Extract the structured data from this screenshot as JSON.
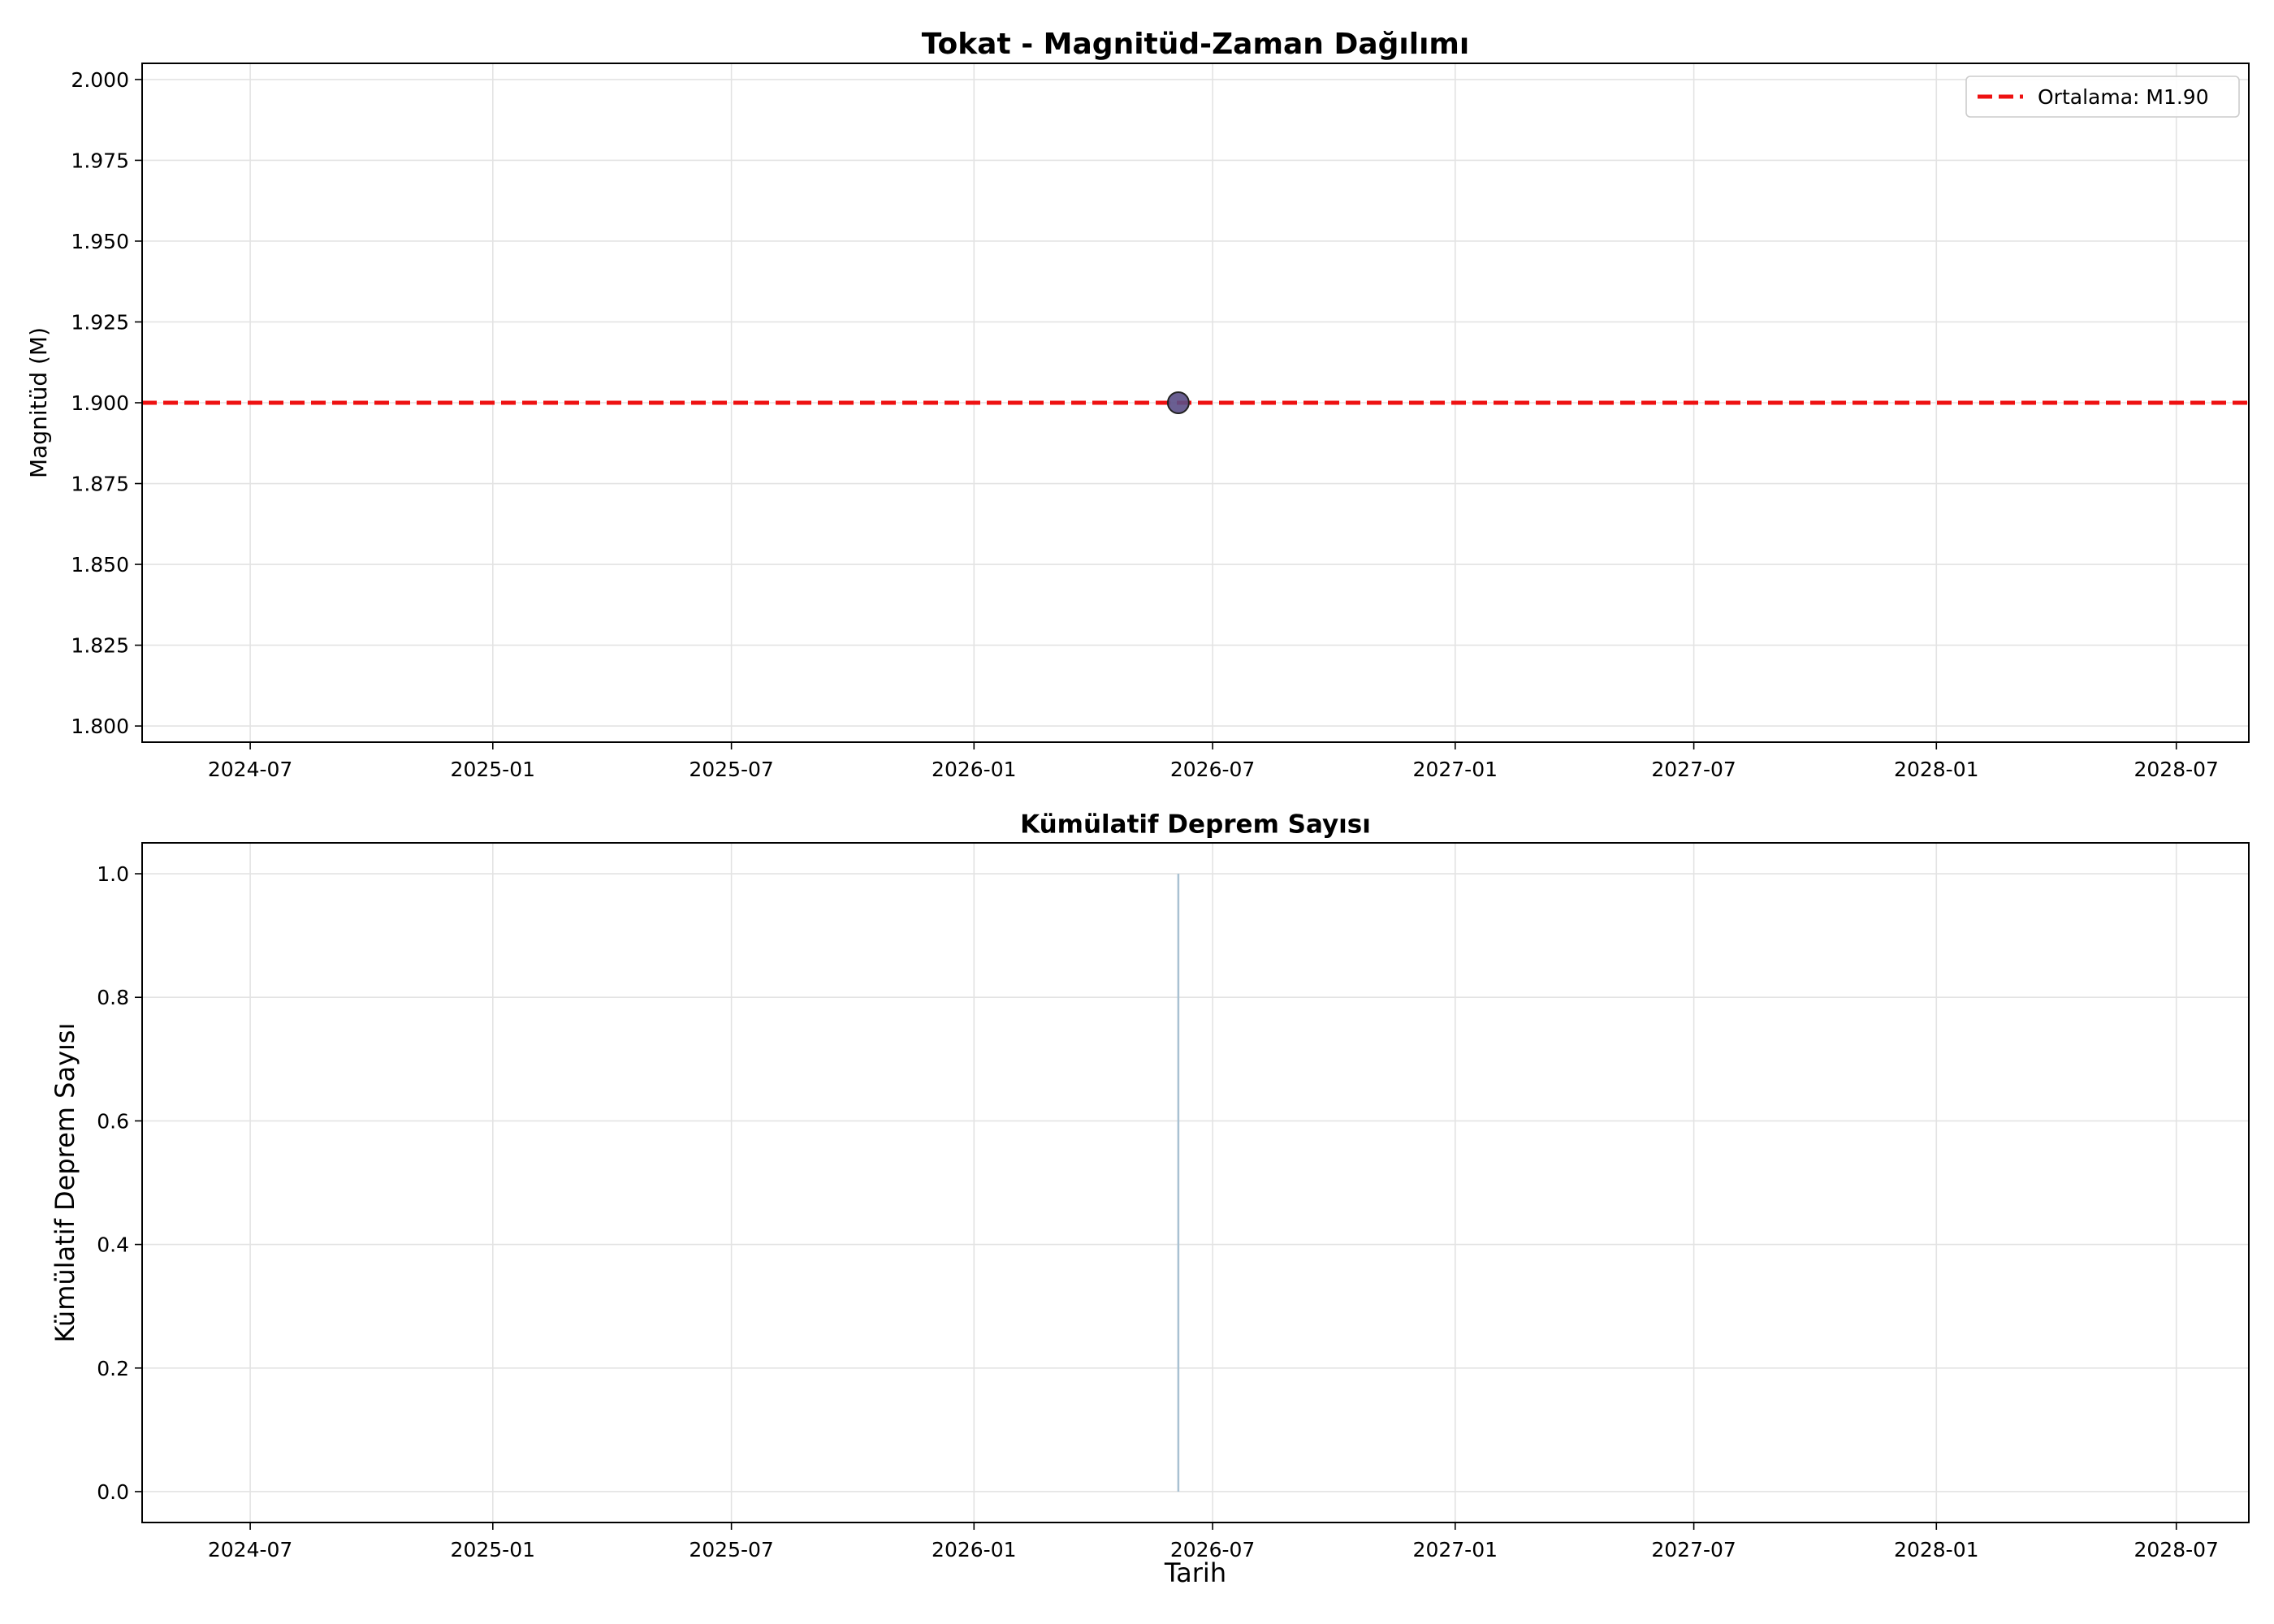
{
  "chart_data": [
    {
      "type": "scatter",
      "title": "Tokat - Magnitüd-Zaman Dağılımı",
      "xlabel": "",
      "ylabel": "Magnitüd (M)",
      "x_ticks": [
        "2024-07",
        "2025-01",
        "2025-07",
        "2026-01",
        "2026-07",
        "2027-01",
        "2027-07",
        "2028-01",
        "2028-07"
      ],
      "y_ticks": [
        "1.800",
        "1.825",
        "1.850",
        "1.875",
        "1.900",
        "1.925",
        "1.950",
        "1.975",
        "2.000"
      ],
      "xlim": [
        "2024-04-10",
        "2028-08-25"
      ],
      "ylim": [
        1.795,
        2.005
      ],
      "grid": true,
      "legend_position": "top-right",
      "points": [
        {
          "x": "2026-06-05",
          "y": 1.9
        }
      ],
      "reference_line": {
        "y": 1.9,
        "label": "Ortalama: M1.90",
        "style": "dashed",
        "color": "#ee1111"
      },
      "marker_color": "#5a4e86"
    },
    {
      "type": "line",
      "title": "Kümülatif Deprem Sayısı",
      "xlabel": "Tarih",
      "ylabel": "Kümülatif Deprem Sayısı",
      "x_ticks": [
        "2024-07",
        "2025-01",
        "2025-07",
        "2026-01",
        "2026-07",
        "2027-01",
        "2027-07",
        "2028-01",
        "2028-07"
      ],
      "y_ticks": [
        "0.0",
        "0.2",
        "0.4",
        "0.6",
        "0.8",
        "1.0"
      ],
      "xlim": [
        "2024-04-10",
        "2028-08-25"
      ],
      "ylim": [
        -0.05,
        1.05
      ],
      "grid": true,
      "series": [
        {
          "x": [
            "2026-06-05",
            "2026-06-05"
          ],
          "values": [
            0,
            1
          ]
        }
      ],
      "line_color": "#a9c1d2"
    }
  ]
}
